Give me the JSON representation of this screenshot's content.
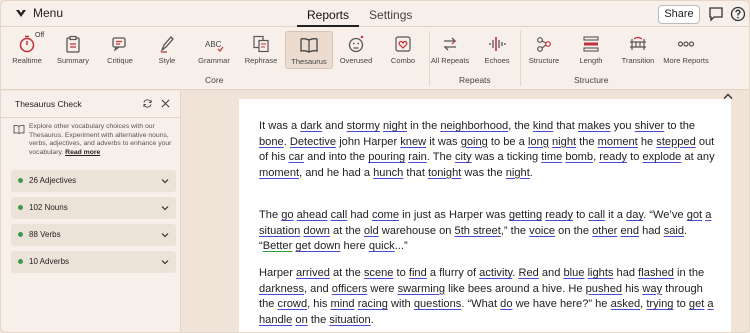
{
  "header": {
    "menu_label": "Menu",
    "tabs": [
      {
        "label": "Reports"
      },
      {
        "label": "Settings"
      }
    ],
    "share_label": "Share"
  },
  "toolbar": {
    "realtime_state": "Off",
    "core_tools": [
      {
        "label": "Realtime",
        "icon": "timer-icon"
      },
      {
        "label": "Summary",
        "icon": "clipboard-icon"
      },
      {
        "label": "Critique",
        "icon": "chat-icon"
      },
      {
        "label": "Style",
        "icon": "pen-icon"
      },
      {
        "label": "Grammar",
        "icon": "abc-icon"
      },
      {
        "label": "Rephrase",
        "icon": "rephrase-icon"
      },
      {
        "label": "Thesaurus",
        "icon": "book-icon"
      },
      {
        "label": "Overused",
        "icon": "face-icon"
      },
      {
        "label": "Combo",
        "icon": "heart-icon"
      }
    ],
    "repeats_tools": [
      {
        "label": "All Repeats",
        "icon": "arrows-icon"
      },
      {
        "label": "Echoes",
        "icon": "waveform-icon"
      }
    ],
    "structure_tools": [
      {
        "label": "Structure",
        "icon": "nodes-icon"
      },
      {
        "label": "Length",
        "icon": "bars-icon"
      },
      {
        "label": "Transition",
        "icon": "bridge-icon"
      },
      {
        "label": "More Reports",
        "icon": "dots-icon"
      }
    ],
    "groups": {
      "core": "Core",
      "repeats": "Repeats",
      "structure": "Structure"
    }
  },
  "panel": {
    "title": "Thesaurus Check",
    "info_text": "Explore other vocabulary choices with our Thesaurus. Experiment with alternative nouns, verbs, adjectives, and adverbs to enhance your vocabulary.",
    "read_more": "Read more",
    "categories": [
      {
        "label": "26 Adjectives"
      },
      {
        "label": "102 Nouns"
      },
      {
        "label": "88 Verbs"
      },
      {
        "label": "10 Adverbs"
      }
    ]
  },
  "colors": {
    "accent_active": "#ecdcd0",
    "dot": "#3a9b4a",
    "underline_blue": "#4a4ad0",
    "underline_red": "#c0303a",
    "underline_green": "#2a9b3a"
  }
}
